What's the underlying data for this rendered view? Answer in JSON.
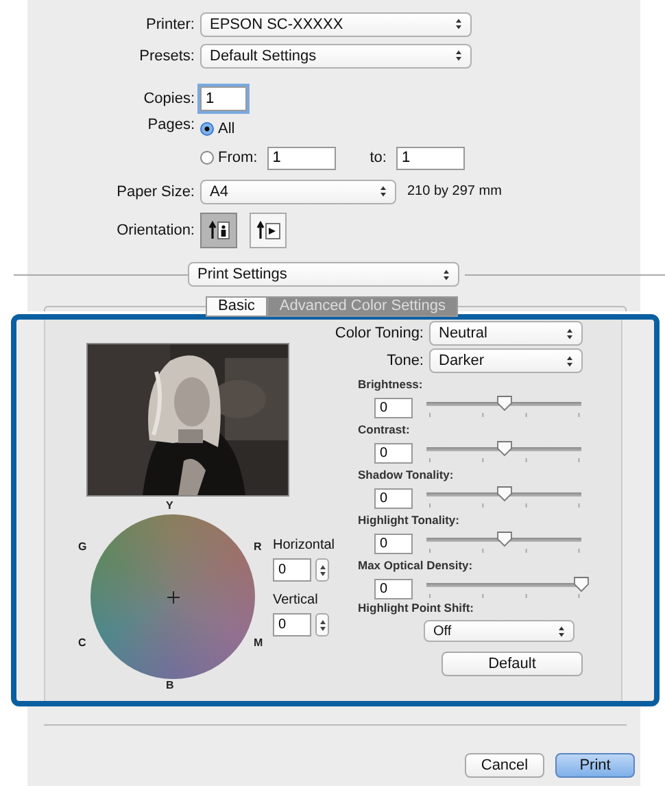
{
  "printer": {
    "label": "Printer:",
    "value": "EPSON SC-XXXXX"
  },
  "presets": {
    "label": "Presets:",
    "value": "Default Settings"
  },
  "copies": {
    "label": "Copies:",
    "value": "1"
  },
  "pages": {
    "label": "Pages:",
    "options": [
      {
        "label": "All",
        "selected": true
      },
      {
        "label": "From:",
        "selected": false
      }
    ],
    "from": "1",
    "to_label": "to:",
    "to": "1"
  },
  "paper_size": {
    "label": "Paper Size:",
    "value": "A4",
    "dimensions": "210 by 297 mm"
  },
  "orientation": {
    "label": "Orientation:",
    "options": [
      {
        "kind": "portrait",
        "selected": true
      },
      {
        "kind": "landscape",
        "selected": false
      }
    ]
  },
  "section": {
    "value": "Print Settings"
  },
  "tabs": [
    {
      "label": "Basic",
      "selected": false
    },
    {
      "label": "Advanced Color Settings",
      "selected": true
    }
  ],
  "color_toning": {
    "label": "Color Toning:",
    "value": "Neutral"
  },
  "tone": {
    "label": "Tone:",
    "value": "Darker"
  },
  "sliders": [
    {
      "label": "Brightness:",
      "value": "0",
      "level": 0.5
    },
    {
      "label": "Contrast:",
      "value": "0",
      "level": 0.5
    },
    {
      "label": "Shadow Tonality:",
      "value": "0",
      "level": 0.5
    },
    {
      "label": "Highlight Tonality:",
      "value": "0",
      "level": 0.5
    },
    {
      "label": "Max Optical Density:",
      "value": "0",
      "level": 1
    }
  ],
  "highlight_point_shift": {
    "label": "Highlight Point Shift:",
    "value": "Off"
  },
  "default_button": "Default",
  "wheel": {
    "labels": [
      "Y",
      "G",
      "R",
      "C",
      "M",
      "B"
    ],
    "horizontal": {
      "label": "Horizontal",
      "value": "0"
    },
    "vertical": {
      "label": "Vertical",
      "value": "0"
    }
  },
  "buttons": [
    {
      "label": "Cancel",
      "kind": "cancel"
    },
    {
      "label": "Print",
      "kind": "default"
    }
  ]
}
